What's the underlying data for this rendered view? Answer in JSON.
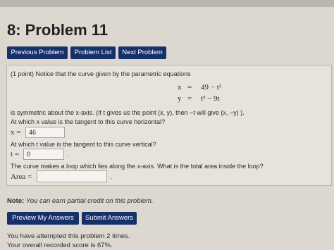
{
  "problem_title": "8: Problem 11",
  "nav": {
    "previous": "Previous Problem",
    "list": "Problem List",
    "next": "Next Problem"
  },
  "problem": {
    "intro": "(1 point) Notice that the curve given by the parametric equations",
    "eq_x_var": "x",
    "eq_x_eq": "=",
    "eq_x_rhs": "49 − t²",
    "eq_y_var": "y",
    "eq_y_eq": "=",
    "eq_y_rhs": "t³ − 9t",
    "symmetric": "is symmetric about the x-axis. (If t gives us the point (x, y), then −t will give (x, −y) ).",
    "q1": "At which x value is the tangent to this curve horizontal?",
    "q1_label": "x =",
    "q1_value": "46",
    "q2": "At which t value is the tangent to this curve vertical?",
    "q2_label": "t =",
    "q2_value": "0",
    "q3": "The curve makes a loop which lies along the x-axis. What is the total area inside the loop?",
    "q3_label": "Area =",
    "q3_value": ""
  },
  "note_label": "Note:",
  "note_text": "You can earn partial credit on this problem.",
  "buttons": {
    "preview": "Preview My Answers",
    "submit": "Submit Answers"
  },
  "status": {
    "attempts": "You have attempted this problem 2 times.",
    "score": "Your overall recorded score is 67%."
  }
}
